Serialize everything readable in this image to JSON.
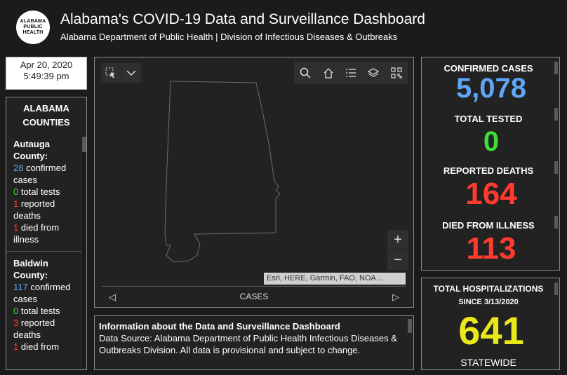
{
  "header": {
    "logo_lines": [
      "ALABAMA",
      "PUBLIC",
      "HEALTH"
    ],
    "title": "Alabama's COVID-19 Data and Surveillance Dashboard",
    "subtitle": "Alabama Department of Public Health | Division of Infectious Diseases & Outbreaks"
  },
  "datetime": {
    "date": "Apr 20, 2020",
    "time": "5:49:39 pm"
  },
  "counties_panel": {
    "title_line1": "ALABAMA",
    "title_line2": "COUNTIES",
    "items": [
      {
        "name": "Autauga County:",
        "confirmed_value": "28",
        "confirmed_label": "confirmed cases",
        "tests_value": "0",
        "tests_label": "total tests",
        "deaths_value": "1",
        "deaths_label": "reported deaths",
        "died_value": "1",
        "died_label": "died from illness"
      },
      {
        "name": "Baldwin County:",
        "confirmed_value": "117",
        "confirmed_label": "confirmed cases",
        "tests_value": "0",
        "tests_label": "total tests",
        "deaths_value": "3",
        "deaths_label": "reported deaths",
        "died_value": "1",
        "died_label": "died from"
      }
    ]
  },
  "map": {
    "tools": [
      "select-icon",
      "dropdown-icon",
      "search-icon",
      "home-icon",
      "list-icon",
      "layers-icon",
      "qr-icon"
    ],
    "zoom_in": "+",
    "zoom_out": "−",
    "attribution": "Esri, HERE, Garmin, FAO, NOA...",
    "footer_label": "CASES"
  },
  "info": {
    "heading": "Information about the Data and Surveillance Dashboard",
    "body": "Data Source: Alabama Department of Public Health Infectious Diseases & Outbreaks Division. All data is provisional and subject to change."
  },
  "stats": {
    "confirmed_label": "CONFIRMED CASES",
    "confirmed_value": "5,078",
    "tested_label": "TOTAL TESTED",
    "tested_value": "0",
    "deaths_label": "REPORTED DEATHS",
    "deaths_value": "164",
    "died_label": "DIED FROM ILLNESS",
    "died_value": "113"
  },
  "hospitalizations": {
    "label_line1": "TOTAL HOSPITALIZATIONS",
    "label_line2": "SINCE 3/13/2020",
    "value": "641",
    "footer": "STATEWIDE"
  },
  "colors": {
    "confirmed": "#5da7f5",
    "tested": "#3fdc3a",
    "deaths": "#ff2a1f",
    "hospital": "#e9e91a"
  }
}
